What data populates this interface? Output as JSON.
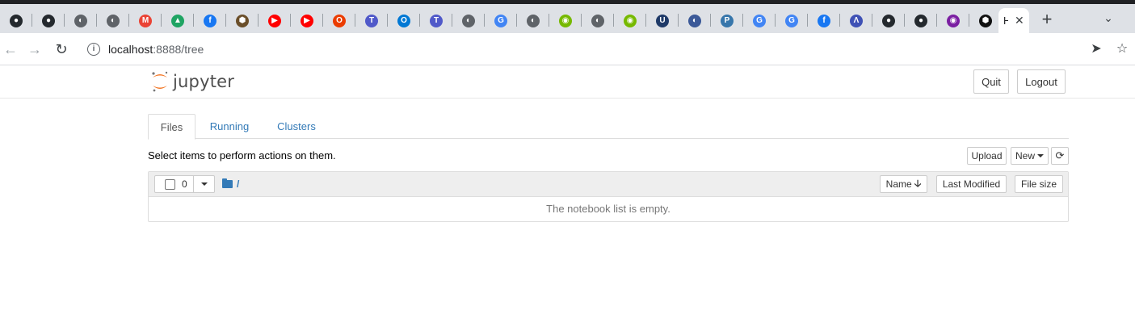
{
  "browser": {
    "tab_favicons": [
      {
        "name": "github-icon",
        "bg": "#24292e",
        "glyph": "●"
      },
      {
        "name": "github-icon",
        "bg": "#24292e",
        "glyph": "●"
      },
      {
        "name": "globe-icon",
        "bg": "#5f6368",
        "glyph": "◐"
      },
      {
        "name": "globe-icon",
        "bg": "#5f6368",
        "glyph": "◐"
      },
      {
        "name": "gmail-icon",
        "bg": "#ea4335",
        "glyph": "M"
      },
      {
        "name": "google-drive-icon",
        "bg": "#1fa463",
        "glyph": "▲"
      },
      {
        "name": "facebook-icon",
        "bg": "#1877f2",
        "glyph": "f"
      },
      {
        "name": "app-icon",
        "bg": "#6b4f2a",
        "glyph": "⬢"
      },
      {
        "name": "youtube-icon",
        "bg": "#ff0000",
        "glyph": "▶"
      },
      {
        "name": "youtube-icon",
        "bg": "#ff0000",
        "glyph": "▶"
      },
      {
        "name": "office-icon",
        "bg": "#eb3c00",
        "glyph": "O"
      },
      {
        "name": "teams-icon",
        "bg": "#5059c9",
        "glyph": "T"
      },
      {
        "name": "outlook-icon",
        "bg": "#0078d4",
        "glyph": "O"
      },
      {
        "name": "teams-icon",
        "bg": "#5059c9",
        "glyph": "T"
      },
      {
        "name": "globe-icon",
        "bg": "#5f6368",
        "glyph": "◐"
      },
      {
        "name": "google-icon",
        "bg": "#4285f4",
        "glyph": "G"
      },
      {
        "name": "globe-icon",
        "bg": "#5f6368",
        "glyph": "◐"
      },
      {
        "name": "nvidia-icon",
        "bg": "#76b900",
        "glyph": "◉"
      },
      {
        "name": "globe-icon",
        "bg": "#5f6368",
        "glyph": "◐"
      },
      {
        "name": "nvidia-icon",
        "bg": "#76b900",
        "glyph": "◉"
      },
      {
        "name": "ul-icon",
        "bg": "#1f3a68",
        "glyph": "U"
      },
      {
        "name": "globe-icon",
        "bg": "#3b5998",
        "glyph": "◐"
      },
      {
        "name": "python-icon",
        "bg": "#3776ab",
        "glyph": "P"
      },
      {
        "name": "translate-icon",
        "bg": "#4285f4",
        "glyph": "G"
      },
      {
        "name": "google-icon",
        "bg": "#4285f4",
        "glyph": "G"
      },
      {
        "name": "facebook-icon",
        "bg": "#1877f2",
        "glyph": "f"
      },
      {
        "name": "app-icon",
        "bg": "#3f51b5",
        "glyph": "Λ"
      },
      {
        "name": "github-icon",
        "bg": "#24292e",
        "glyph": "●"
      },
      {
        "name": "github-icon",
        "bg": "#24292e",
        "glyph": "●"
      },
      {
        "name": "app-icon",
        "bg": "#7b1fa2",
        "glyph": "◉"
      },
      {
        "name": "app-icon",
        "bg": "#111111",
        "glyph": "⬢"
      }
    ],
    "active_tab_title": "H",
    "url_host": "localhost",
    "url_path": ":8888/tree"
  },
  "jupyter": {
    "logo_text": "jupyter",
    "quit_label": "Quit",
    "logout_label": "Logout",
    "tabs": [
      "Files",
      "Running",
      "Clusters"
    ],
    "hint": "Select items to perform actions on them.",
    "upload_label": "Upload",
    "new_label": "New",
    "selected_count": "0",
    "breadcrumb": "/",
    "sort_name_label": "Name",
    "sort_modified_label": "Last Modified",
    "sort_size_label": "File size",
    "empty_message": "The notebook list is empty."
  },
  "colors": {
    "link": "#337ab7",
    "jupyter_orange": "#f37726"
  }
}
